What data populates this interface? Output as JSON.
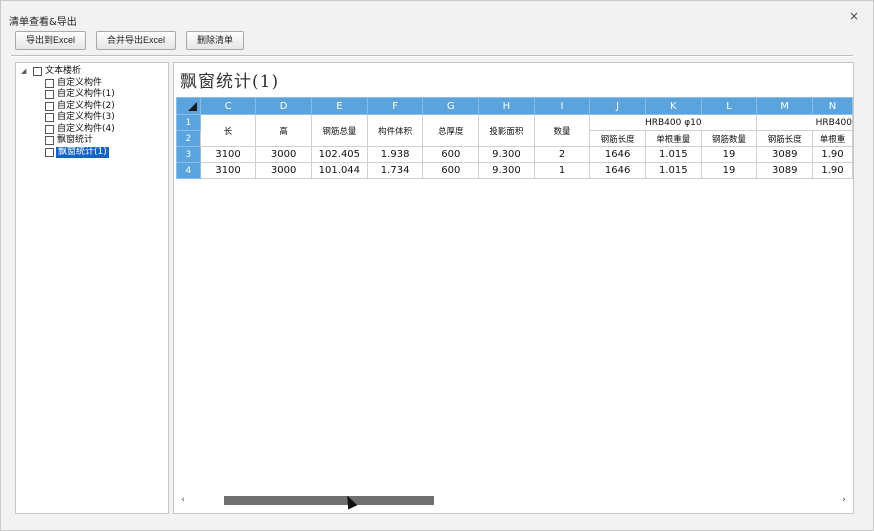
{
  "window": {
    "title": "清单查看&导出",
    "close_glyph": "×"
  },
  "toolbar": {
    "export_excel": "导出到Excel",
    "merge_export": "合并导出Excel",
    "delete_list": "删除清单"
  },
  "tree": {
    "expander": "◢",
    "root": "文本楼析",
    "items": [
      "自定义构件",
      "自定义构件(1)",
      "自定义构件(2)",
      "自定义构件(3)",
      "自定义构件(4)",
      "飘窗统计",
      "飘窗统计(1)"
    ],
    "selected_index": 6
  },
  "sheet": {
    "title": "飘窗统计(1)",
    "columns": [
      "C",
      "D",
      "E",
      "F",
      "G",
      "H",
      "I",
      "J",
      "K",
      "L",
      "M",
      "N"
    ],
    "row_numbers": [
      "1",
      "2",
      "3",
      "4"
    ],
    "headers": {
      "length": "长",
      "height": "高",
      "rebar_total": "钢筋总量",
      "volume": "构件体积",
      "thickness": "总厚度",
      "projected_area": "投影面积",
      "count": "数量",
      "group1": "HRB400 φ10",
      "group2": "HRB400",
      "rebar_length": "钢筋长度",
      "unit_weight": "单根重量",
      "rebar_count": "钢筋数量",
      "rebar_length2": "钢筋长度",
      "unit_weight2": "单根重"
    },
    "rows": [
      [
        "3100",
        "3000",
        "102.405",
        "1.938",
        "600",
        "9.300",
        "2",
        "1646",
        "1.015",
        "19",
        "3089",
        "1.90"
      ],
      [
        "3100",
        "3000",
        "101.044",
        "1.734",
        "600",
        "9.300",
        "1",
        "1646",
        "1.015",
        "19",
        "3089",
        "1.90"
      ]
    ]
  },
  "scrollbar": {
    "left_arrow": "‹",
    "right_arrow": "›"
  }
}
